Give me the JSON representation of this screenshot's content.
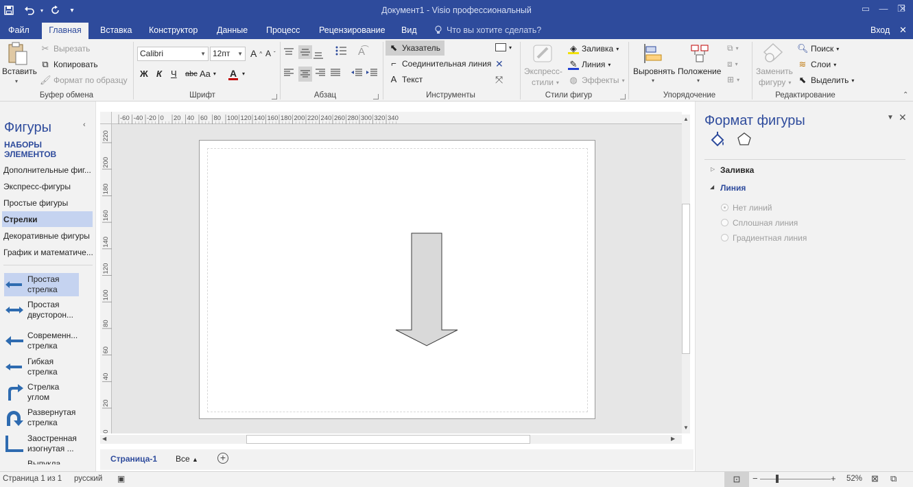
{
  "window": {
    "title": "Документ1 - Visio профессиональный",
    "signin": "Вход"
  },
  "menu": {
    "tabs": [
      "Файл",
      "Главная",
      "Вставка",
      "Конструктор",
      "Данные",
      "Процесс",
      "Рецензирование",
      "Вид"
    ],
    "tellme": "Что вы хотите сделать?"
  },
  "ribbon": {
    "clipboard": {
      "paste": "Вставить",
      "cut": "Вырезать",
      "copy": "Копировать",
      "format_painter": "Формат по образцу",
      "label": "Буфер обмена"
    },
    "font": {
      "name": "Calibri",
      "size": "12пт",
      "grow": "A",
      "shrink": "A",
      "bold": "Ж",
      "italic": "К",
      "underline": "Ч",
      "strike": "abc",
      "case": "Aa",
      "color": "A",
      "label": "Шрифт"
    },
    "paragraph": {
      "label": "Абзац"
    },
    "tools": {
      "pointer": "Указатель",
      "connector": "Соединительная линия",
      "text": "Текст",
      "label": "Инструменты"
    },
    "shape_styles": {
      "quick_styles_1": "Экспресс-",
      "quick_styles_2": "стили",
      "fill": "Заливка",
      "line": "Линия",
      "effects": "Эффекты",
      "label": "Стили фигур"
    },
    "arrange": {
      "align": "Выровнять",
      "position": "Положение",
      "label": "Упорядочение"
    },
    "editing": {
      "change_shape_1": "Заменить",
      "change_shape_2": "фигуру",
      "find": "Поиск",
      "layers": "Слои",
      "select": "Выделить",
      "label": "Редактирование"
    }
  },
  "shapes_pane": {
    "title": "Фигуры",
    "stencils_header": "НАБОРЫ ЭЛЕМЕНТОВ",
    "stencils": [
      "Дополнительные фиг...",
      "Экспресс-фигуры",
      "Простые фигуры",
      "Стрелки",
      "Декоративные фигуры",
      "График и математиче..."
    ],
    "selected_stencil": "Стрелки",
    "shapes": [
      {
        "l1": "Простая",
        "l2": "стрелка"
      },
      {
        "l1": "Простая",
        "l2": "двусторон..."
      },
      {
        "l1": "Современн...",
        "l2": "стрелка"
      },
      {
        "l1": "Гибкая",
        "l2": "стрелка"
      },
      {
        "l1": "Стрелка",
        "l2": "углом"
      },
      {
        "l1": "Развернутая",
        "l2": "стрелка"
      },
      {
        "l1": "Заостренная",
        "l2": "изогнутая ..."
      },
      {
        "l1": "Выпукла...",
        "l2": ""
      }
    ]
  },
  "rulers": {
    "h": [
      "-60",
      "-40",
      "-20",
      "0",
      "20",
      "40",
      "60",
      "80",
      "100",
      "120",
      "140",
      "160",
      "180",
      "200",
      "220",
      "240",
      "260",
      "280",
      "300",
      "320",
      "340"
    ],
    "v": [
      "220",
      "200",
      "180",
      "160",
      "140",
      "120",
      "100",
      "80",
      "60",
      "40",
      "20",
      "0"
    ]
  },
  "page_tabs": {
    "current": "Страница-1",
    "all": "Все"
  },
  "format_pane": {
    "title": "Формат фигуры",
    "fill": "Заливка",
    "line": "Линия",
    "options": [
      "Нет линий",
      "Сплошная линия",
      "Градиентная линия"
    ]
  },
  "status": {
    "page": "Страница 1 из 1",
    "language": "русский",
    "zoom": "52%"
  },
  "colors": {
    "accent": "#2e4b9c",
    "selected": "#c5d3f0",
    "arrow_fill": "#d9d9d9"
  }
}
